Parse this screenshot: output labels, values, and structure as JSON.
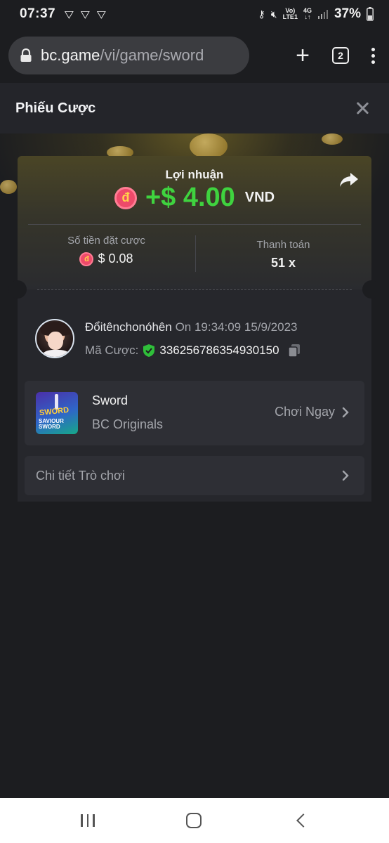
{
  "status_bar": {
    "time": "07:37",
    "signal_top": "Vo)",
    "signal_bottom": "LTE1",
    "net_top": "4G",
    "net_bottom": "↓↑",
    "battery": "37%"
  },
  "browser": {
    "url_host": "bc.game",
    "url_path": "/vi/game/sword",
    "tab_count": "2"
  },
  "page": {
    "title": "Phiếu Cược"
  },
  "bet": {
    "profit_label": "Lợi nhuận",
    "coin_symbol": "đ",
    "profit_amount": "+$ 4.00",
    "currency": "VND",
    "stake_label": "Số tiền đặt cược",
    "stake_value": "$ 0.08",
    "payout_label": "Thanh toán",
    "payout_value": "51 x"
  },
  "user": {
    "name": "Đổitênchonóhên",
    "date": "On 19:34:09 15/9/2023",
    "bet_id_label": "Mã Cược:",
    "bet_id": "336256786354930150"
  },
  "game": {
    "thumb_title": "SWORD",
    "thumb_subtitle_1": "SAVIOUR",
    "thumb_subtitle_2": "SWORD",
    "name": "Sword",
    "provider": "BC Originals",
    "play_label": "Chơi Ngay"
  },
  "details": {
    "label": "Chi tiết Trò chơi"
  },
  "colors": {
    "profit_green": "#3fd33f",
    "coin_pink": "#ee4a6a",
    "background": "#1c1d20",
    "card": "#26272c"
  }
}
